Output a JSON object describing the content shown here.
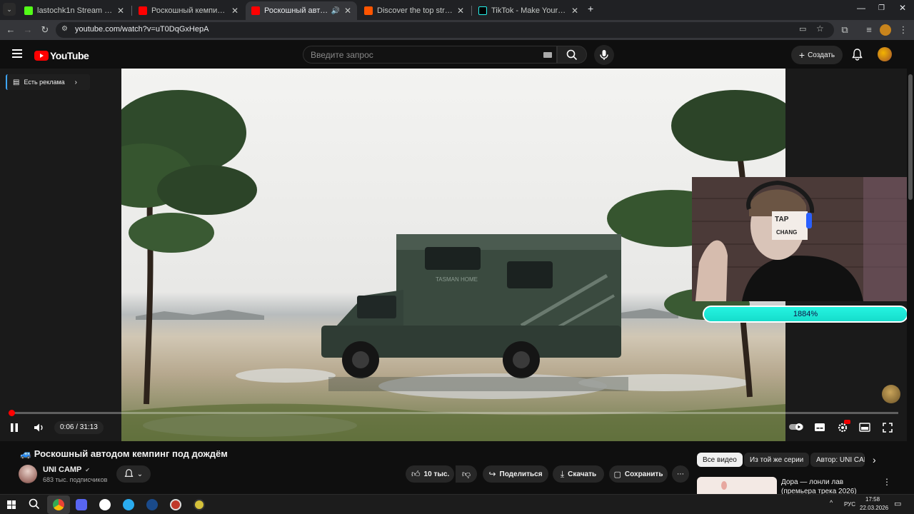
{
  "browser": {
    "tabs": [
      {
        "title": "lastochk1n Stream - Watch Live",
        "favicon_color": "#53fc18",
        "active": false
      },
      {
        "title": "Роскошный кемпинг на лодке",
        "favicon_color": "#ff0000",
        "active": false
      },
      {
        "title": "Роскошный автодом кемпинг",
        "favicon_color": "#ff0000",
        "active": true
      },
      {
        "title": "Discover the top streamed music",
        "favicon_color": "#ff5500",
        "active": false
      },
      {
        "title": "TikTok - Make Your Day",
        "favicon_color": "#000000",
        "active": false
      }
    ],
    "url": "youtube.com/watch?v=uT0DqGxHepA"
  },
  "yt_header": {
    "logo_text": "YouTube",
    "search_placeholder": "Введите запрос",
    "create_label": "Создать"
  },
  "ad_badge": "Есть реклама",
  "overlay": {
    "progress_text": "1884%",
    "progress_fraction": 1.0
  },
  "player": {
    "time": "0:06 / 31:13",
    "played_fraction": 0.003
  },
  "video": {
    "title": "🚙 Роскошный автодом кемпинг под дождём",
    "channel": "UNI CAMP",
    "subscribers": "683 тыс. подписчиков",
    "likes": "10 тыс.",
    "share_label": "Поделиться",
    "download_label": "Скачать",
    "save_label": "Сохранить"
  },
  "camper_text": "TASMAN HOME",
  "recommendations": {
    "chips": [
      "Все видео",
      "Из той же серии",
      "Автор: UNI CAMP"
    ],
    "first_title": "Дора — лонли лав (премьера трека 2026)"
  },
  "taskbar": {
    "lang": "РУС",
    "time": "17:58",
    "date": "22.03.2026"
  },
  "colors": {
    "yt_red": "#ff0000",
    "accent_cyan": "#18d8c6",
    "bg": "#0f0f0f"
  }
}
